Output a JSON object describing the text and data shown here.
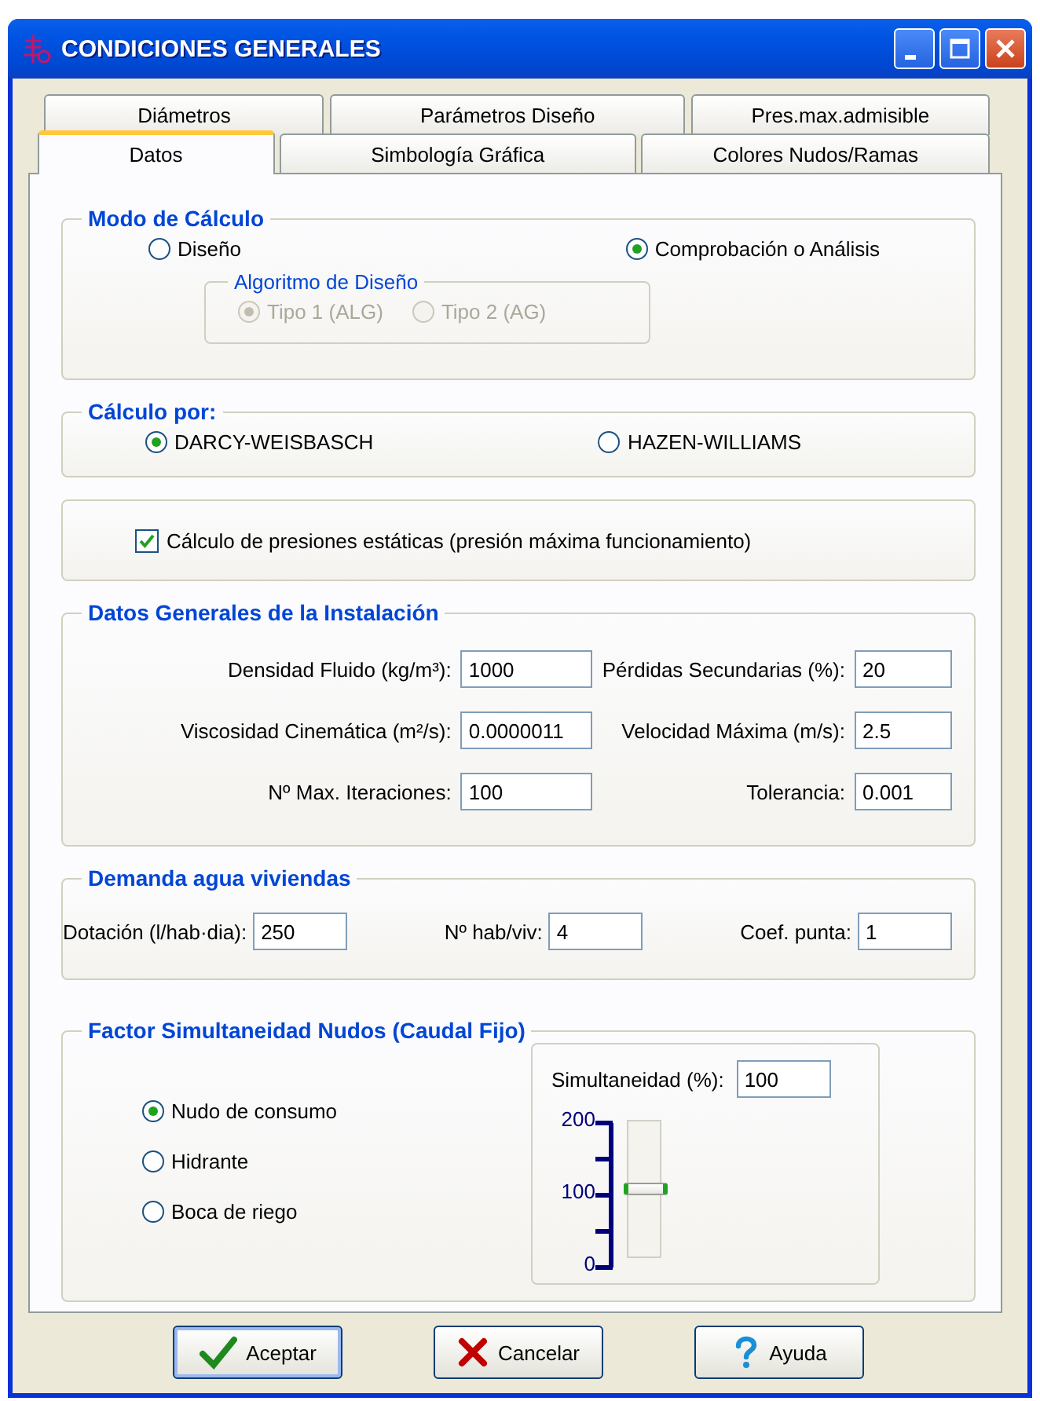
{
  "window": {
    "title": "CONDICIONES GENERALES"
  },
  "tab_rows": [
    [
      {
        "label": "Diámetros",
        "selected": false
      },
      {
        "label": "Parámetros Diseño",
        "selected": false
      },
      {
        "label": "Pres.max.admisible",
        "selected": false
      }
    ],
    [
      {
        "label": "Datos",
        "selected": true
      },
      {
        "label": "Simbología Gráfica",
        "selected": false
      },
      {
        "label": "Colores Nudos/Ramas",
        "selected": false
      }
    ]
  ],
  "modo_calculo": {
    "title": "Modo de Cálculo",
    "options": [
      {
        "label": "Diseño",
        "selected": false
      },
      {
        "label": "Comprobación o Análisis",
        "selected": true
      }
    ],
    "algoritmo": {
      "title": "Algoritmo de Diseño",
      "disabled": true,
      "options": [
        {
          "label": "Tipo 1 (ALG)",
          "selected": true
        },
        {
          "label": "Tipo 2 (AG)",
          "selected": false
        }
      ]
    }
  },
  "calculo_por": {
    "title": "Cálculo por:",
    "options": [
      {
        "label": "DARCY-WEISBASCH",
        "selected": true
      },
      {
        "label": "HAZEN-WILLIAMS",
        "selected": false
      }
    ]
  },
  "presiones_estaticas": {
    "label": "Cálculo de presiones estáticas (presión máxima funcionamiento)",
    "checked": true
  },
  "datos_generales": {
    "title": "Datos Generales de la Instalación",
    "fields": [
      {
        "label": "Densidad Fluido (kg/m³):",
        "value": "1000"
      },
      {
        "label": "Pérdidas Secundarias (%):",
        "value": "20"
      },
      {
        "label": "Viscosidad Cinemática (m²/s):",
        "value": "0.0000011"
      },
      {
        "label": "Velocidad Máxima (m/s):",
        "value": "2.5"
      },
      {
        "label": "Nº Max. Iteraciones:",
        "value": "100"
      },
      {
        "label": "Tolerancia:",
        "value": "0.001"
      }
    ]
  },
  "demanda": {
    "title": "Demanda agua viviendas",
    "fields": [
      {
        "label": "Dotación (l/hab·dia):",
        "value": "250"
      },
      {
        "label": "Nº hab/viv:",
        "value": "4"
      },
      {
        "label": "Coef. punta:",
        "value": "1"
      }
    ]
  },
  "factor": {
    "title": "Factor Simultaneidad Nudos (Caudal Fijo)",
    "options": [
      {
        "label": "Nudo de consumo",
        "selected": true
      },
      {
        "label": "Hidrante",
        "selected": false
      },
      {
        "label": "Boca de riego",
        "selected": false
      }
    ],
    "simultaneidad": {
      "label": "Simultaneidad (%):",
      "value": "100",
      "level": 0.5,
      "ticks": [
        "200",
        "100",
        "0"
      ]
    }
  },
  "buttons": [
    {
      "label": "Aceptar",
      "kind": "accept"
    },
    {
      "label": "Cancelar",
      "kind": "cancel"
    },
    {
      "label": "Ayuda",
      "kind": "help"
    }
  ]
}
